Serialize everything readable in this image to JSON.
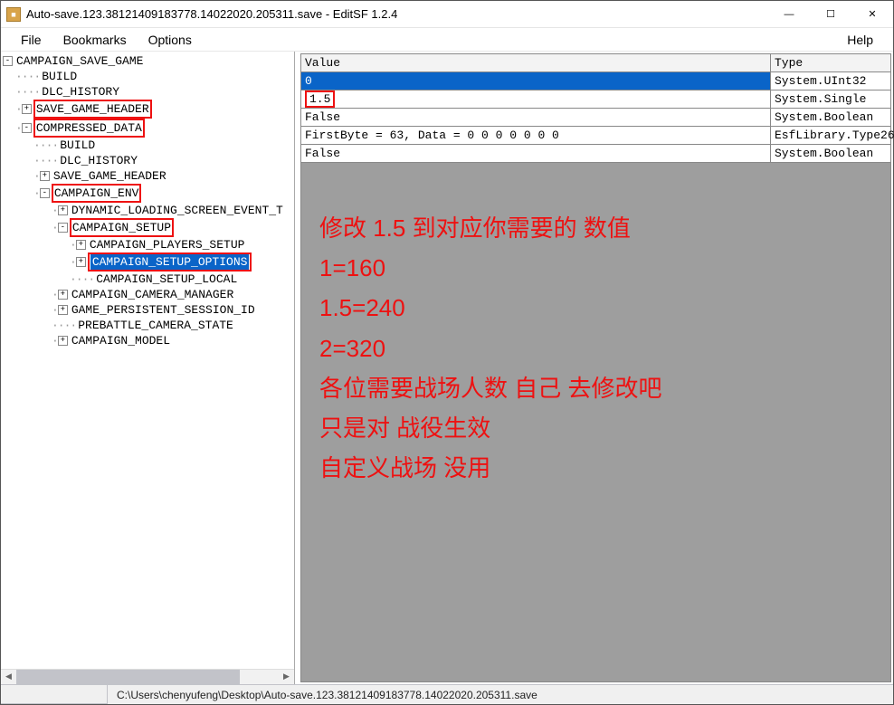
{
  "window": {
    "title": "Auto-save.123.38121409183778.14022020.205311.save - EditSF 1.2.4"
  },
  "menu": {
    "file": "File",
    "bookmarks": "Bookmarks",
    "options": "Options",
    "help": "Help"
  },
  "tree": {
    "n0": "CAMPAIGN_SAVE_GAME",
    "n0_0": "BUILD",
    "n0_1": "DLC_HISTORY",
    "n0_2": "SAVE_GAME_HEADER",
    "n0_3": "COMPRESSED_DATA",
    "n0_3_0": "BUILD",
    "n0_3_1": "DLC_HISTORY",
    "n0_3_2": "SAVE_GAME_HEADER",
    "n0_3_3": "CAMPAIGN_ENV",
    "n0_3_3_0": "DYNAMIC_LOADING_SCREEN_EVENT_T",
    "n0_3_3_1": "CAMPAIGN_SETUP",
    "n0_3_3_1_0": "CAMPAIGN_PLAYERS_SETUP",
    "n0_3_3_1_1": "CAMPAIGN_SETUP_OPTIONS",
    "n0_3_3_1_2": "CAMPAIGN_SETUP_LOCAL",
    "n0_3_3_2": "CAMPAIGN_CAMERA_MANAGER",
    "n0_3_3_3": "GAME_PERSISTENT_SESSION_ID",
    "n0_3_3_4": "PREBATTLE_CAMERA_STATE",
    "n0_3_3_5": "CAMPAIGN_MODEL"
  },
  "grid": {
    "head_value": "Value",
    "head_type": "Type",
    "rows": [
      {
        "v": "0",
        "t": "System.UInt32"
      },
      {
        "v": "1.5",
        "t": "System.Single"
      },
      {
        "v": "False",
        "t": "System.Boolean"
      },
      {
        "v": "FirstByte = 63, Data = 0 0 0 0 0 0 0",
        "t": "EsfLibrary.Type26"
      },
      {
        "v": "False",
        "t": "System.Boolean"
      }
    ]
  },
  "annotation": {
    "l1": "修改 1.5 到对应你需要的 数值",
    "l2": "1=160",
    "l3": "1.5=240",
    "l4": "2=320",
    "l5": "各位需要战场人数 自己 去修改吧",
    "l6": "只是对 战役生效",
    "l7": "自定义战场 没用"
  },
  "status": {
    "path": "C:\\Users\\chenyufeng\\Desktop\\Auto-save.123.38121409183778.14022020.205311.save"
  }
}
